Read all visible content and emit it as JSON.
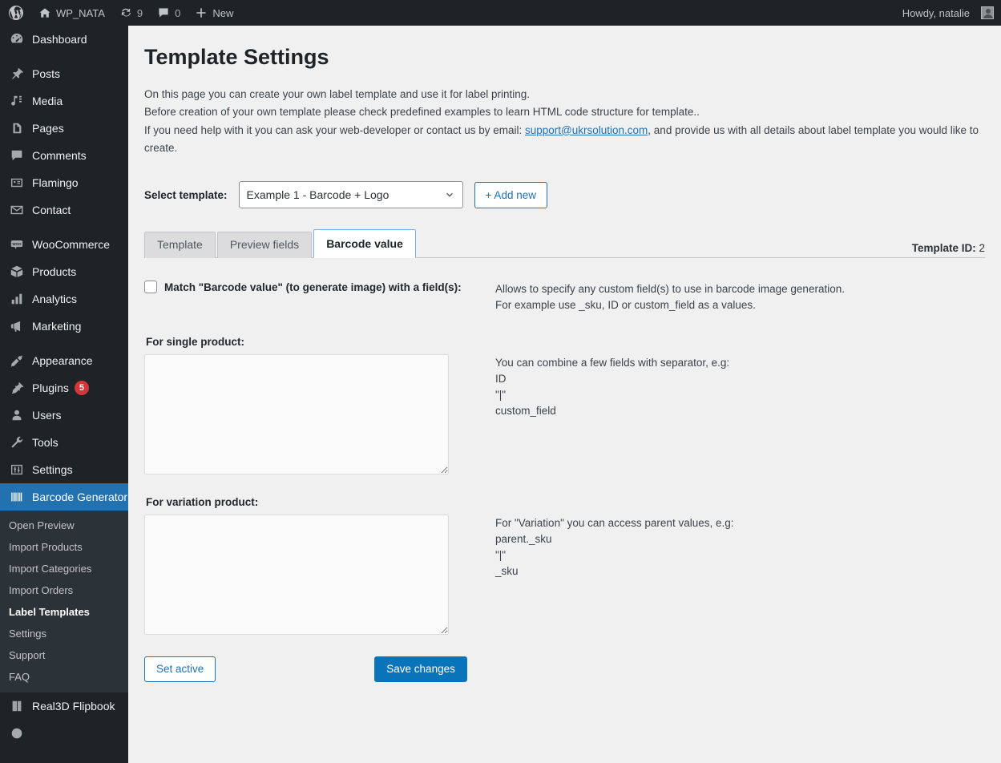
{
  "adminbar": {
    "logo_icon": "wordpress-logo-icon",
    "site_icon": "home-icon",
    "site_name": "WP_NATA",
    "updates_icon": "updates-icon",
    "updates_count": "9",
    "comments_icon": "comment-bubble-icon",
    "comments_count": "0",
    "new_icon": "plus-icon",
    "new_label": "New",
    "howdy": "Howdy, natalie",
    "avatar_icon": "avatar-icon"
  },
  "sidebar": {
    "items": [
      {
        "label": "Dashboard",
        "icon": "dashboard-icon",
        "sep_after": true
      },
      {
        "label": "Posts",
        "icon": "pin-icon"
      },
      {
        "label": "Media",
        "icon": "media-icon"
      },
      {
        "label": "Pages",
        "icon": "pages-icon"
      },
      {
        "label": "Comments",
        "icon": "comment-bubble-icon"
      },
      {
        "label": "Flamingo",
        "icon": "flamingo-icon"
      },
      {
        "label": "Contact",
        "icon": "envelope-icon",
        "sep_after": true
      },
      {
        "label": "WooCommerce",
        "icon": "woocommerce-icon"
      },
      {
        "label": "Products",
        "icon": "box-icon"
      },
      {
        "label": "Analytics",
        "icon": "bar-chart-icon"
      },
      {
        "label": "Marketing",
        "icon": "megaphone-icon",
        "sep_after": true
      },
      {
        "label": "Appearance",
        "icon": "paintbrush-icon"
      },
      {
        "label": "Plugins",
        "icon": "plug-icon",
        "badge": "5"
      },
      {
        "label": "Users",
        "icon": "user-icon"
      },
      {
        "label": "Tools",
        "icon": "wrench-icon"
      },
      {
        "label": "Settings",
        "icon": "sliders-icon"
      }
    ],
    "current_item": {
      "label": "Barcode Generator",
      "icon": "barcode-icon"
    },
    "submenu": [
      {
        "label": "Open Preview"
      },
      {
        "label": "Import Products"
      },
      {
        "label": "Import Categories"
      },
      {
        "label": "Import Orders"
      },
      {
        "label": "Label Templates",
        "current": true
      },
      {
        "label": "Settings"
      },
      {
        "label": "Support"
      },
      {
        "label": "FAQ"
      }
    ],
    "trailing_items": [
      {
        "label": "Real3D Flipbook",
        "icon": "book-icon"
      }
    ]
  },
  "page": {
    "title": "Template Settings",
    "intro_line1": "On this page you can create your own label template and use it for label printing.",
    "intro_line2": "Before creation of your own template please check predefined examples to learn HTML code structure for template..",
    "intro_line3_before": "If you need help with it you can ask your web-developer or contact us by email: ",
    "intro_email": "support@ukrsolution.com",
    "intro_line3_after": ", and provide us with all details about label template you would like to create."
  },
  "select_row": {
    "label": "Select template:",
    "selected": "Example 1 - Barcode + Logo",
    "options": [
      "Example 1 - Barcode + Logo"
    ],
    "chevron_icon": "chevron-down-icon",
    "add_new_label": "+ Add new"
  },
  "tabs": {
    "items": [
      {
        "label": "Template",
        "active": false
      },
      {
        "label": "Preview fields",
        "active": false
      },
      {
        "label": "Barcode value",
        "active": true
      }
    ],
    "template_id_label": "Template ID:",
    "template_id_value": "2"
  },
  "panel": {
    "match_checkbox_label": "Match \"Barcode value\" (to generate image) with a field(s):",
    "match_checked": false,
    "match_help_line1": "Allows to specify any custom field(s) to use in barcode image generation.",
    "match_help_line2": "For example use _sku, ID or custom_field as a values.",
    "single_label": "For single product:",
    "single_value": "",
    "single_help_line1": "You can combine a few fields with separator, e.g:",
    "single_help_line2": "ID",
    "single_help_line3": "\"|\"",
    "single_help_line4": "custom_field",
    "variation_label": "For variation product:",
    "variation_value": "",
    "variation_help_line1": "For \"Variation\" you can access parent values, e.g:",
    "variation_help_line2": "parent._sku",
    "variation_help_line3": "\"|\"",
    "variation_help_line4": "_sku",
    "set_active_label": "Set active",
    "save_changes_label": "Save changes"
  },
  "colors": {
    "admin_dark": "#1d2327",
    "submenu_dark": "#2c3338",
    "accent_blue": "#2271b1",
    "primary_button": "#0a74ba",
    "badge_red": "#d63638",
    "page_bg": "#f0f0f1"
  }
}
